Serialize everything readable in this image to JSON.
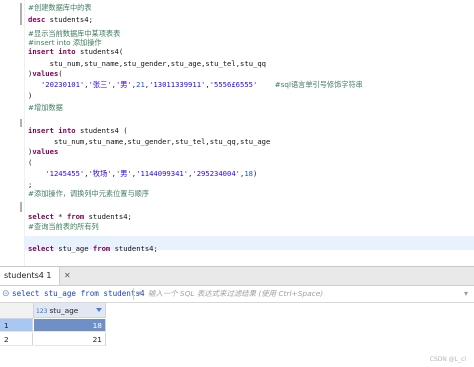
{
  "editor": {
    "lines": [
      {
        "segments": [
          {
            "c": "cm",
            "t": "#创建数据库中的表"
          }
        ]
      },
      {
        "segments": [
          {
            "c": "kw",
            "t": "desc "
          },
          {
            "c": "pl",
            "t": "students4;"
          }
        ]
      },
      {
        "segments": [
          {
            "c": "cm",
            "t": "#显示当前数据库中某项表表"
          }
        ]
      },
      {
        "segments": [
          {
            "c": "cm",
            "t": "#insert into 添加操作"
          }
        ]
      },
      {
        "segments": [
          {
            "c": "kw",
            "t": "insert into "
          },
          {
            "c": "pl",
            "t": "students4("
          }
        ]
      },
      {
        "segments": [
          {
            "c": "pl",
            "t": "     stu_num,stu_name,stu_gender,stu_age,stu_tel,stu_qq"
          }
        ]
      },
      {
        "segments": [
          {
            "c": "pl",
            "t": ")"
          },
          {
            "c": "kw",
            "t": "values"
          },
          {
            "c": "pl",
            "t": "("
          }
        ]
      },
      {
        "segments": [
          {
            "c": "pl",
            "t": "   "
          },
          {
            "c": "st",
            "t": "'20230101'"
          },
          {
            "c": "pl",
            "t": ","
          },
          {
            "c": "st",
            "t": "'张三'"
          },
          {
            "c": "pl",
            "t": ","
          },
          {
            "c": "st",
            "t": "'男'"
          },
          {
            "c": "pl",
            "t": ","
          },
          {
            "c": "nm",
            "t": "21"
          },
          {
            "c": "pl",
            "t": ","
          },
          {
            "c": "st",
            "t": "'13011339911'"
          },
          {
            "c": "pl",
            "t": ","
          },
          {
            "c": "st",
            "t": "'5556£6555'"
          },
          {
            "c": "pl",
            "t": "    "
          },
          {
            "c": "cm",
            "t": "#sql语言单引号修饰字符串"
          }
        ]
      },
      {
        "segments": [
          {
            "c": "pl",
            "t": ")"
          }
        ]
      },
      {
        "segments": [
          {
            "c": "cm",
            "t": "#增加数据"
          }
        ]
      },
      {
        "segments": [
          {
            "c": "pl",
            "t": ""
          }
        ]
      },
      {
        "segments": [
          {
            "c": "kw",
            "t": "insert into "
          },
          {
            "c": "pl",
            "t": "students4 ("
          }
        ]
      },
      {
        "segments": [
          {
            "c": "pl",
            "t": "      stu_num,stu_name,stu_gender,stu_tel,stu_qq,stu_age"
          }
        ]
      },
      {
        "segments": [
          {
            "c": "pl",
            "t": ")"
          },
          {
            "c": "kw",
            "t": "values"
          }
        ]
      },
      {
        "segments": [
          {
            "c": "pl",
            "t": "("
          }
        ]
      },
      {
        "segments": [
          {
            "c": "pl",
            "t": "    "
          },
          {
            "c": "st",
            "t": "'1245455'"
          },
          {
            "c": "pl",
            "t": ","
          },
          {
            "c": "st",
            "t": "'牧场'"
          },
          {
            "c": "pl",
            "t": ","
          },
          {
            "c": "st",
            "t": "'男'"
          },
          {
            "c": "pl",
            "t": ","
          },
          {
            "c": "st",
            "t": "'1144099341'"
          },
          {
            "c": "pl",
            "t": ","
          },
          {
            "c": "st",
            "t": "'295234004'"
          },
          {
            "c": "pl",
            "t": ","
          },
          {
            "c": "nm",
            "t": "18"
          },
          {
            "c": "pl",
            "t": ")"
          }
        ]
      },
      {
        "segments": [
          {
            "c": "pl",
            "t": ";"
          }
        ]
      },
      {
        "segments": [
          {
            "c": "cm",
            "t": "#添加操作，调换列中元素位置与顺序"
          }
        ]
      },
      {
        "segments": [
          {
            "c": "pl",
            "t": ""
          }
        ]
      },
      {
        "segments": [
          {
            "c": "kw",
            "t": "select "
          },
          {
            "c": "pl",
            "t": "* "
          },
          {
            "c": "kw",
            "t": "from "
          },
          {
            "c": "pl",
            "t": "students4;"
          }
        ]
      },
      {
        "segments": [
          {
            "c": "cm",
            "t": "#查询当前表的所有列"
          }
        ]
      },
      {
        "segments": [
          {
            "c": "pl",
            "t": ""
          }
        ]
      },
      {
        "segments": [
          {
            "c": "kw",
            "t": "select "
          },
          {
            "c": "pl",
            "t": "stu_age "
          },
          {
            "c": "kw",
            "t": "from "
          },
          {
            "c": "pl",
            "t": "students4;"
          }
        ]
      }
    ]
  },
  "results": {
    "tab_label": "students4 1",
    "tab_close": "✕",
    "filter_query": "select stu_age from students4",
    "filter_placeholder": "输入一个 SQL 表达式来过滤结果 (使用 Ctrl+Space)",
    "filter_icon": "sql-query-icon",
    "funnel_icon": "filter-icon",
    "column_type": "123",
    "column_name": "stu_age",
    "rows": [
      {
        "num": "1",
        "value": "18"
      },
      {
        "num": "2",
        "value": "21"
      }
    ]
  },
  "watermark": "CSDN @L_cl",
  "colors": {
    "accent": "#1a3fbf",
    "selected_cell": "#6f8fc7",
    "selected_row_header": "#a9c7f3"
  }
}
